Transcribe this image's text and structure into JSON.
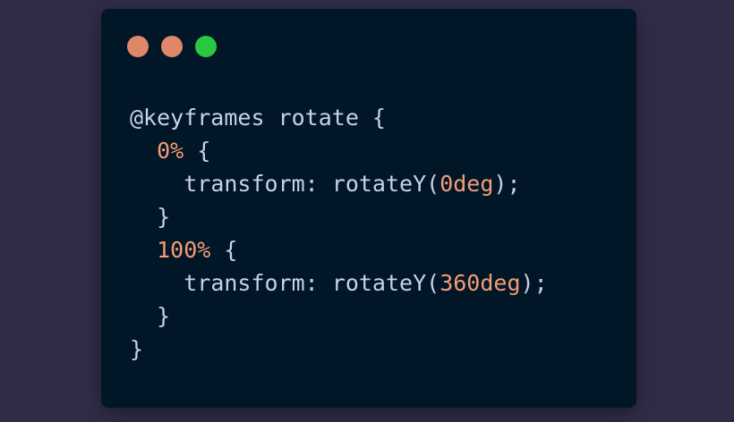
{
  "window": {
    "controls": [
      {
        "name": "close",
        "color": "#e0876a"
      },
      {
        "name": "minimize",
        "color": "#e0876a"
      },
      {
        "name": "maximize",
        "color": "#28c840"
      }
    ]
  },
  "code": {
    "lines": [
      {
        "indent": "",
        "tokens": [
          {
            "text": "@keyframes rotate {",
            "kind": "txt"
          }
        ]
      },
      {
        "indent": "  ",
        "tokens": [
          {
            "text": "0%",
            "kind": "num"
          },
          {
            "text": " {",
            "kind": "txt"
          }
        ]
      },
      {
        "indent": "    ",
        "tokens": [
          {
            "text": "transform: rotateY(",
            "kind": "txt"
          },
          {
            "text": "0deg",
            "kind": "num"
          },
          {
            "text": ");",
            "kind": "txt"
          }
        ]
      },
      {
        "indent": "  ",
        "tokens": [
          {
            "text": "}",
            "kind": "txt"
          }
        ]
      },
      {
        "indent": "  ",
        "tokens": [
          {
            "text": "100%",
            "kind": "num"
          },
          {
            "text": " {",
            "kind": "txt"
          }
        ]
      },
      {
        "indent": "    ",
        "tokens": [
          {
            "text": "transform: rotateY(",
            "kind": "txt"
          },
          {
            "text": "360deg",
            "kind": "num"
          },
          {
            "text": ");",
            "kind": "txt"
          }
        ]
      },
      {
        "indent": "  ",
        "tokens": [
          {
            "text": "}",
            "kind": "txt"
          }
        ]
      },
      {
        "indent": "",
        "tokens": [
          {
            "text": "}",
            "kind": "txt"
          }
        ]
      }
    ]
  },
  "colors": {
    "background": "#302c46",
    "window": "#011627",
    "text": "#c9d1e6",
    "number": "#f39c77"
  }
}
